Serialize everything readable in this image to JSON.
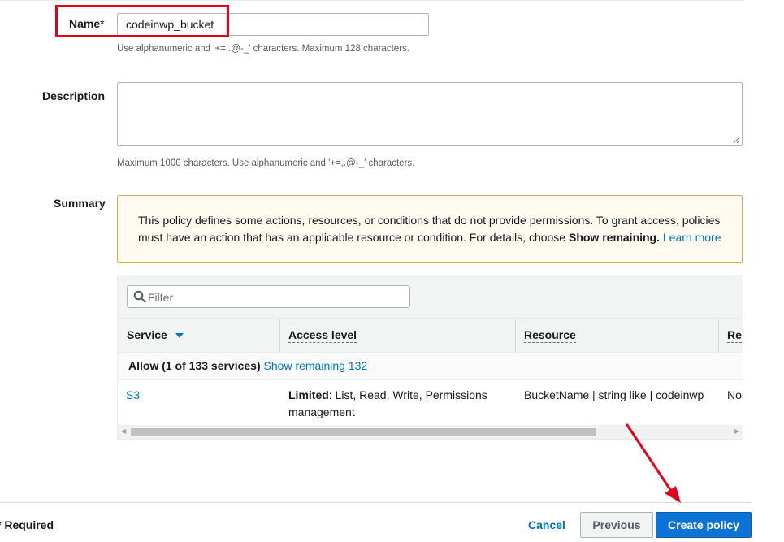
{
  "form": {
    "name": {
      "label": "Name",
      "required_mark": "*",
      "value": "codeinwp_bucket",
      "hint": "Use alphanumeric and '+=,.@-_' characters. Maximum 128 characters."
    },
    "description": {
      "label": "Description",
      "value": "",
      "hint": "Maximum 1000 characters. Use alphanumeric and '+=,.@-_' characters."
    },
    "summary": {
      "label": "Summary",
      "warning_text": "This policy defines some actions, resources, or conditions that do not provide permissions. To grant access, policies must have an action that has an applicable resource or condition. For details, choose ",
      "warning_bold": "Show remaining.",
      "warning_link": "Learn more"
    }
  },
  "table": {
    "filter_placeholder": "Filter",
    "columns": [
      "Service",
      "Access level",
      "Resource",
      "Re"
    ],
    "group": {
      "label": "Allow (1 of 133 services)",
      "link": "Show remaining 132"
    },
    "rows": [
      {
        "service": "S3",
        "access_bold": "Limited",
        "access_rest": ": List, Read, Write, Permissions management",
        "resource": "BucketName | string like | codeinwp",
        "request": "Nor"
      }
    ]
  },
  "footer": {
    "required_note": "* Required",
    "cancel_label": "Cancel",
    "previous_label": "Previous",
    "create_label": "Create policy"
  },
  "colors": {
    "link": "#0073bb",
    "primary_button": "#0b73d5",
    "highlight": "#e4001b",
    "warning_border": "#e0a84c"
  }
}
